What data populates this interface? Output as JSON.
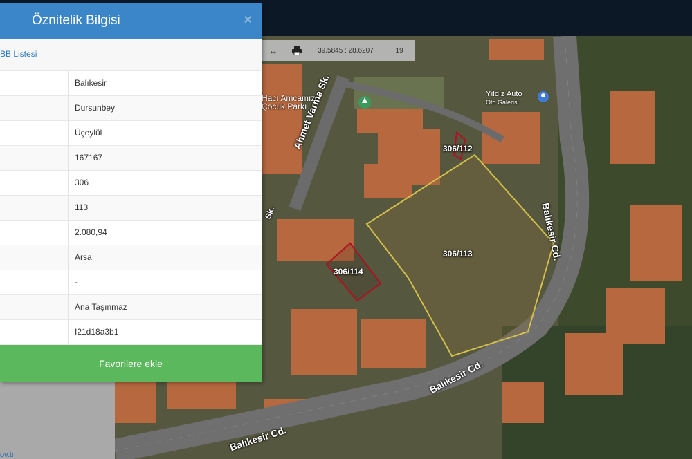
{
  "panel": {
    "title": "Öznitelik Bilgisi",
    "close_label": "×",
    "list_link": "BB Listesi",
    "rows": [
      {
        "value": "Balıkesir"
      },
      {
        "value": "Dursunbey"
      },
      {
        "value": "Üçeylül"
      },
      {
        "value": "167167"
      },
      {
        "value": "306"
      },
      {
        "value": "113"
      },
      {
        "value": "2.080,94"
      },
      {
        "value": "Arsa"
      },
      {
        "value": "-"
      },
      {
        "value": "Ana Taşınmaz"
      },
      {
        "value": "I21d18a3b1"
      }
    ],
    "favorite_button": "Favorilere ekle"
  },
  "toolbar": {
    "measure_icon": "↔",
    "print_icon": "print-icon",
    "coordinates": "39.5845 : 28.6207",
    "zoom_level": "19"
  },
  "footer": {
    "link_fragment": "ov.tr"
  },
  "map": {
    "parcel_labels": {
      "main": "306/113",
      "north": "306/112",
      "west": "306/114"
    },
    "streets": {
      "ahmet_varma": "Ahmet Varma Sk.",
      "balikesir_east": "Balıkesir Cd.",
      "balikesir_south": "Balıkesir Cd.",
      "balikesir_southwest": "Balıkesir Cd.",
      "sk_fragment": "Sk."
    },
    "pois": {
      "park_line1": "Hacı Amcamız",
      "park_line2": "Çocuk Parkı",
      "auto_line1": "Yıldız Auto",
      "auto_line2": "Oto Galerisi"
    },
    "colors": {
      "selected_parcel": "#d4c04a",
      "neighbor_parcel": "#b01020",
      "header_blue": "#3a86c8",
      "button_green": "#5cb85c"
    }
  }
}
